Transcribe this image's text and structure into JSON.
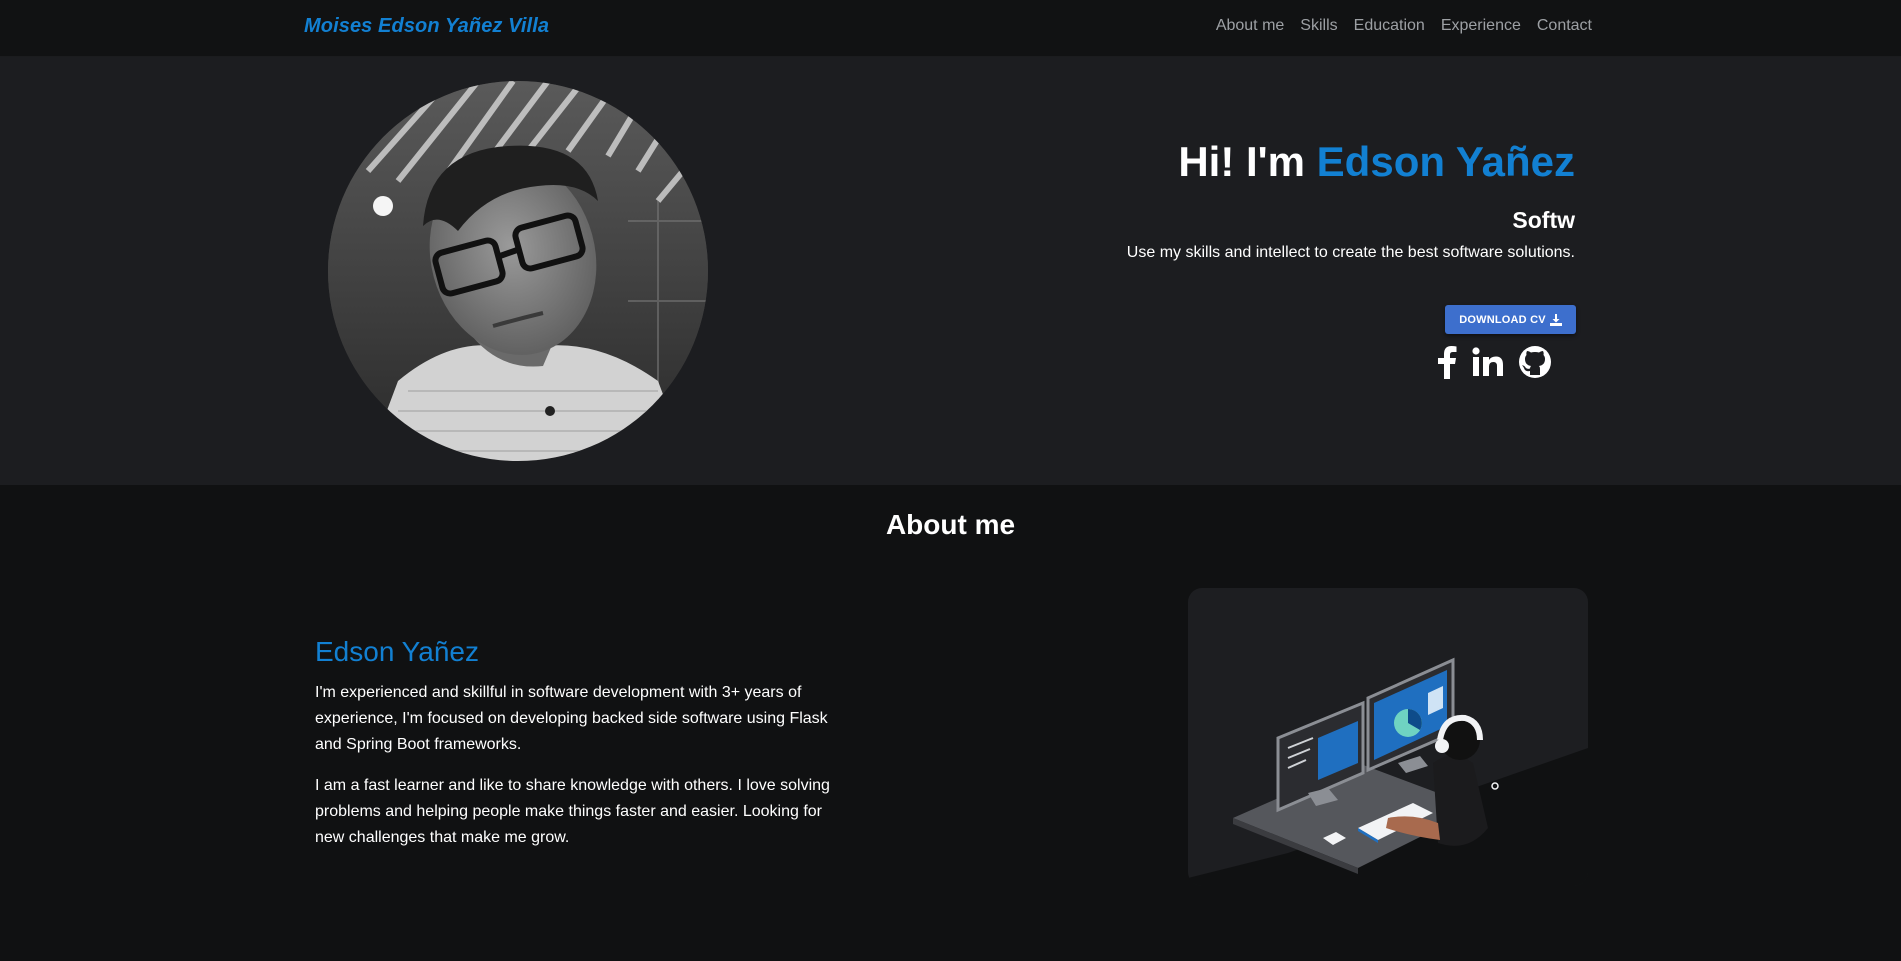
{
  "navbar": {
    "brand": "Moises Edson Yañez Villa",
    "links": [
      "About me",
      "Skills",
      "Education",
      "Experience",
      "Contact"
    ]
  },
  "hero": {
    "greeting": "Hi! I'm ",
    "name": "Edson Yañez",
    "typed_text": "Softw",
    "tagline": "Use my skills and intellect to create the best software solutions.",
    "cv_button": "DOWNLOAD CV",
    "socials": [
      "facebook-icon",
      "linkedin-icon",
      "github-icon"
    ]
  },
  "about": {
    "title": "About me",
    "name": "Edson Yañez",
    "paragraph1": "I'm experienced and skillful in software development with 3+ years of experience, I'm focused on developing backed side software using Flask and Spring Boot frameworks.",
    "paragraph2": "I am a fast learner and like to share knowledge with others. I love solving problems and helping people make things faster and easier. Looking for new challenges that make me grow."
  },
  "colors": {
    "accent": "#1280d2",
    "button": "#3d6fcd",
    "hero_bg": "#1c1d20",
    "page_bg": "#101112"
  }
}
